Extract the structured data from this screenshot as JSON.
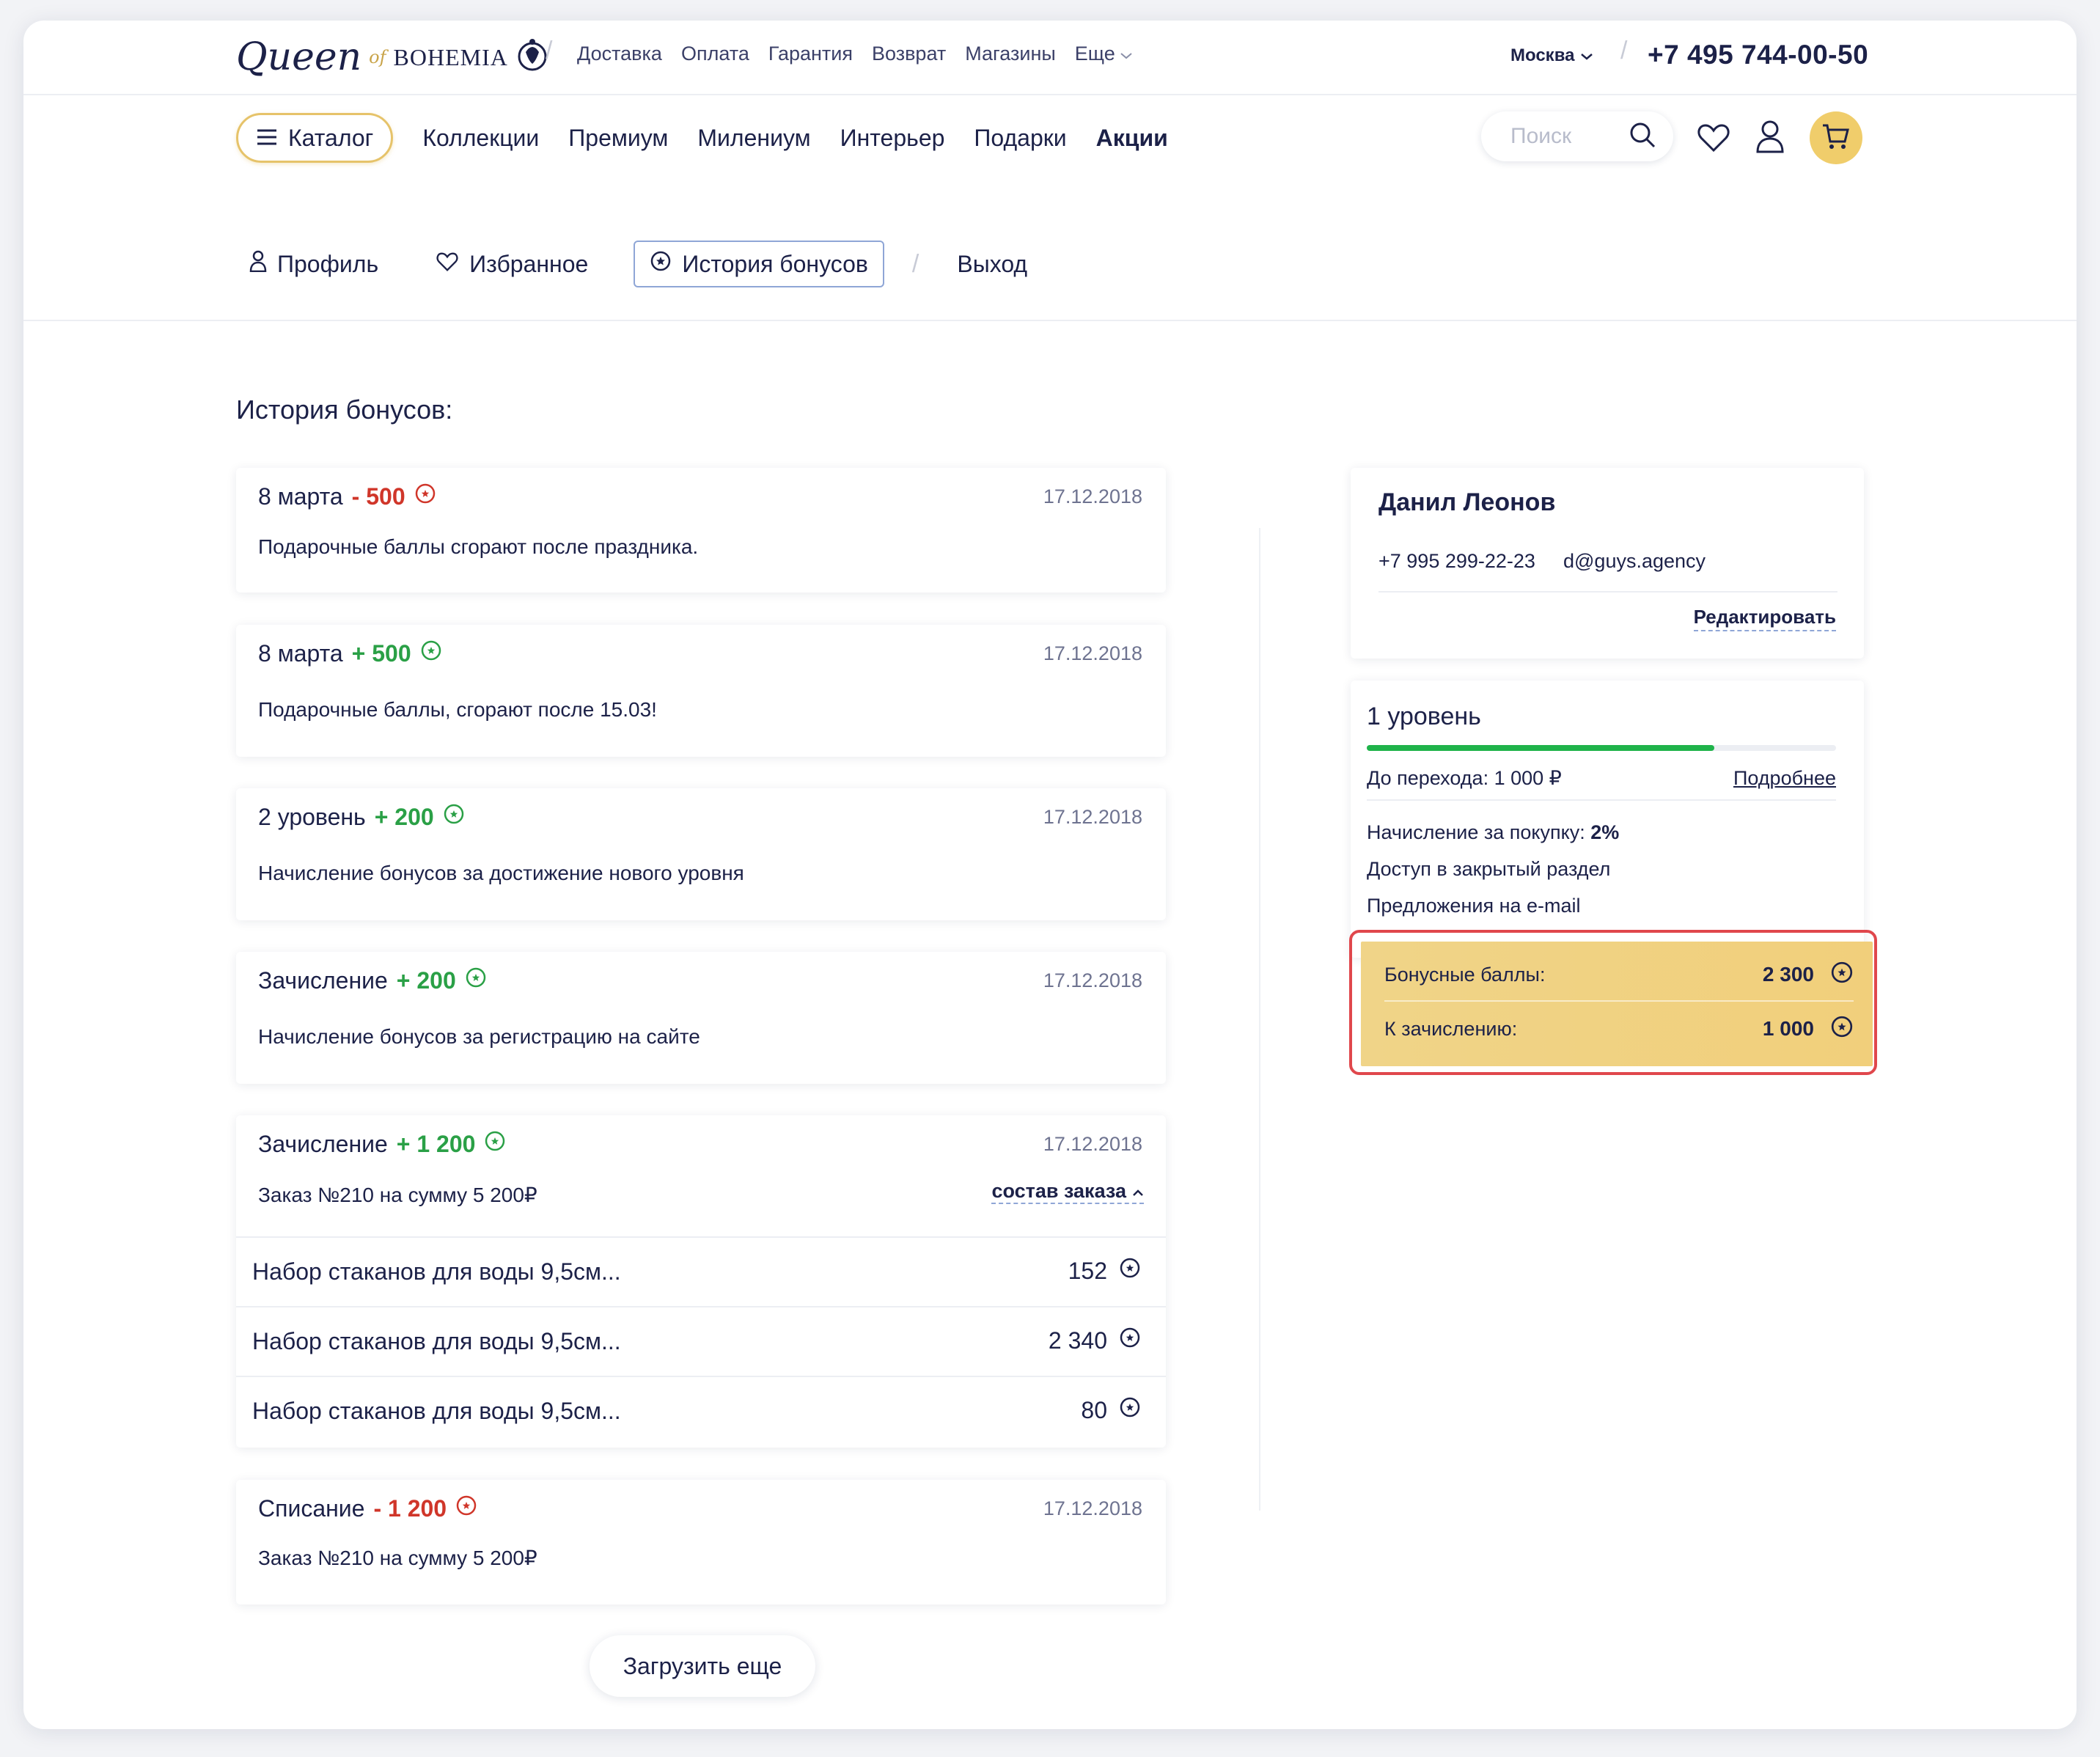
{
  "header": {
    "logo": {
      "queen": "Queen",
      "of": "of",
      "bohemia": "BOHEMIA"
    },
    "top_links": [
      "Доставка",
      "Оплата",
      "Гарантия",
      "Возврат",
      "Магазины",
      "Еще"
    ],
    "city": "Москва",
    "phone": "+7 495 744-00-50"
  },
  "main_nav": {
    "catalog_label": "Каталог",
    "links": [
      "Коллекции",
      "Премиум",
      "Милениум",
      "Интерьер",
      "Подарки",
      "Акции"
    ],
    "search_placeholder": "Поиск"
  },
  "account_tabs": {
    "profile": "Профиль",
    "favorites": "Избранное",
    "bonus_history": "История бонусов",
    "logout": "Выход"
  },
  "page_title": "История бонусов:",
  "history": [
    {
      "title": "8 марта",
      "amount": "- 500",
      "date": "17.12.2018",
      "desc": "Подарочные баллы сгорают после праздника."
    },
    {
      "title": "8 марта",
      "amount": "+ 500",
      "date": "17.12.2018",
      "desc": "Подарочные баллы, сгорают после 15.03!"
    },
    {
      "title": "2 уровень",
      "amount": "+ 200",
      "date": "17.12.2018",
      "desc": "Начисление бонусов за достижение нового уровня"
    },
    {
      "title": "Зачисление",
      "amount": "+ 200",
      "date": "17.12.2018",
      "desc": "Начисление бонусов за регистрацию на сайте"
    },
    {
      "title": "Зачисление",
      "amount": "+ 1 200",
      "date": "17.12.2018",
      "desc": "Заказ №210 на сумму 5 200₽",
      "order_link": "состав заказа",
      "items": [
        {
          "name": "Набор стаканов для воды 9,5см...",
          "value": "152"
        },
        {
          "name": "Набор стаканов для воды 9,5см...",
          "value": "2 340"
        },
        {
          "name": "Набор стаканов для воды 9,5см...",
          "value": "80"
        }
      ]
    },
    {
      "title": "Списание",
      "amount": "- 1 200",
      "date": "17.12.2018",
      "desc": "Заказ №210 на сумму 5 200₽"
    }
  ],
  "load_more": "Загрузить еще",
  "profile": {
    "name": "Данил Леонов",
    "phone": "+7 995 299-22-23",
    "email": "d@guys.agency",
    "edit": "Редактировать"
  },
  "level": {
    "title": "1 уровень",
    "progress": 0.74,
    "to_next": "До перехода: 1 000 ₽",
    "more": "Подробнее",
    "accrual_label": "Начисление за покупку: ",
    "accrual_value": "2%",
    "perk1": "Доступ в закрытый раздел",
    "perk2": "Предложения на e-mail"
  },
  "bonus": {
    "points_label": "Бонусные баллы:",
    "points_value": "2 300",
    "pending_label": "К зачислению:",
    "pending_value": "1 000"
  },
  "colors": {
    "accent": "#f0cd6b",
    "negative": "#d0362a",
    "positive": "#2aa046",
    "text": "#1c2148",
    "highlight": "#e0474c"
  }
}
